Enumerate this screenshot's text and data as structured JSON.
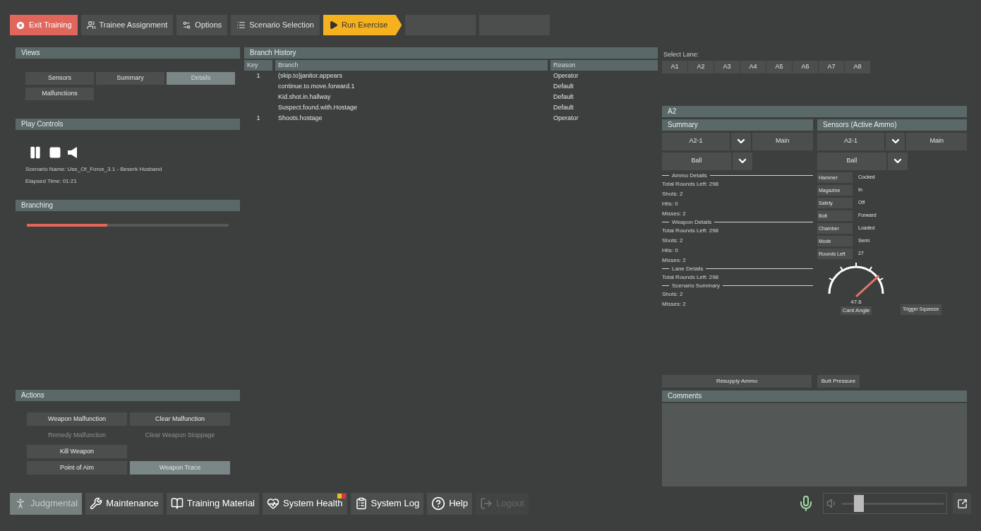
{
  "toolbar": [
    {
      "kind": "exit",
      "label": "Exit Training"
    },
    {
      "kind": "trainees",
      "label": "Trainee Assignment"
    },
    {
      "kind": "options",
      "label": "Options"
    },
    {
      "kind": "scenario",
      "label": "Scenario Selection"
    },
    {
      "kind": "run",
      "label": "Run Exercise"
    },
    {
      "kind": "blank"
    },
    {
      "kind": "blank"
    }
  ],
  "views": {
    "title": "Views",
    "buttons": [
      {
        "label": "Sensors",
        "selected": false
      },
      {
        "label": "Summary",
        "selected": false
      },
      {
        "label": "Details",
        "selected": true
      },
      {
        "label": "Malfunctions",
        "selected": false
      }
    ]
  },
  "play_controls": {
    "title": "Play Controls",
    "scenario_name": "Scenario Name: Use_Of_Force_3.1 - Beserk Husband",
    "elapsed_time": "Elapsed Time: 01:21"
  },
  "branching": {
    "title": "Branching",
    "level": 0.4
  },
  "actions": {
    "title": "Actions",
    "buttons": [
      {
        "label": "Weapon Malfunction",
        "disabled": false,
        "selected": false
      },
      {
        "label": "Clear Malfunction",
        "disabled": false,
        "selected": false
      },
      {
        "label": "Remedy Malfunction",
        "disabled": true,
        "selected": false
      },
      {
        "label": "Clear Weapon Stoppage",
        "disabled": true,
        "selected": false
      },
      {
        "label": "Kill Weapon",
        "disabled": false,
        "selected": false
      },
      {
        "kind": "gap"
      },
      {
        "label": "Point of Aim",
        "disabled": false,
        "selected": false
      },
      {
        "label": "Weapon Trace",
        "disabled": false,
        "selected": true
      }
    ]
  },
  "branch_history": {
    "title": "Branch History",
    "columns": [
      "Key",
      "Branch",
      "Reason"
    ],
    "rows": [
      {
        "key": "1",
        "branch": "(skip.to)janitor.appears",
        "reason": "Operator"
      },
      {
        "branch": "continue.to.move.forward.1",
        "reason": "Default"
      },
      {
        "branch": "Kid.shot.in.hallway",
        "reason": "Default"
      },
      {
        "branch": "Suspect.found.with.Hostage",
        "reason": "Default"
      },
      {
        "key": "1",
        "branch": "Shoots.hostage",
        "reason": "Operator"
      }
    ]
  },
  "select_lane": {
    "label": "Select Lane:",
    "lanes": [
      "A1",
      "A2",
      "A3",
      "A4",
      "A5",
      "A6",
      "A7",
      "A8"
    ]
  },
  "lane": {
    "title": "A2",
    "summary": {
      "title": "Summary",
      "weapon": "A2-1",
      "mode": "Main",
      "ammo": "Ball",
      "sections": [
        {
          "title": "Ammo Details",
          "lines": [
            "Total Rounds Left: 298",
            "Shots: 2",
            "Hits: 0",
            "Misses: 2"
          ]
        },
        {
          "title": "Weapon Details",
          "lines": [
            "Total Rounds Left: 298",
            "Shots: 2",
            "Hits: 0",
            "Misses: 2"
          ]
        },
        {
          "title": "Lane Details",
          "lines": [
            "Total Rounds Left: 298"
          ]
        },
        {
          "title": "Scenario Summary",
          "lines": [
            "Shots: 2",
            "Misses: 2"
          ]
        }
      ]
    },
    "sensors": {
      "title": "Sensors (Active Ammo)",
      "weapon": "A2-1",
      "mode": "Main",
      "ammo": "Ball",
      "rows": [
        {
          "label": "Hammer",
          "value": "Cocked"
        },
        {
          "label": "Magazine",
          "value": "In"
        },
        {
          "label": "Safety",
          "value": "Off"
        },
        {
          "label": "Bolt",
          "value": "Forward"
        },
        {
          "label": "Chamber",
          "value": "Loaded"
        },
        {
          "label": "Mode",
          "value": "Semi"
        },
        {
          "label": "Rounds Left",
          "value": "27"
        }
      ],
      "gauge": {
        "reading": "47.6",
        "label": "Cant Angle"
      },
      "trigger": "Trigger Squeeze"
    },
    "buttons": [
      "Resupply Ammo",
      "Butt Pressure"
    ]
  },
  "comments": {
    "title": "Comments"
  },
  "nav": [
    {
      "kind": "judgmental",
      "label": "Judgmental",
      "selected": true,
      "disabled": false
    },
    {
      "kind": "maintenance",
      "label": "Maintenance",
      "selected": false,
      "disabled": false
    },
    {
      "kind": "training",
      "label": "Training Material",
      "selected": false,
      "disabled": false
    },
    {
      "kind": "health",
      "label": "System Health",
      "selected": false,
      "disabled": false,
      "alert": true
    },
    {
      "kind": "log",
      "label": "System Log",
      "selected": false,
      "disabled": false
    },
    {
      "kind": "help",
      "label": "Help",
      "selected": false,
      "disabled": false
    },
    {
      "kind": "logout",
      "label": "Logout",
      "selected": false,
      "disabled": true
    }
  ],
  "volume": {
    "level": 0.12
  }
}
